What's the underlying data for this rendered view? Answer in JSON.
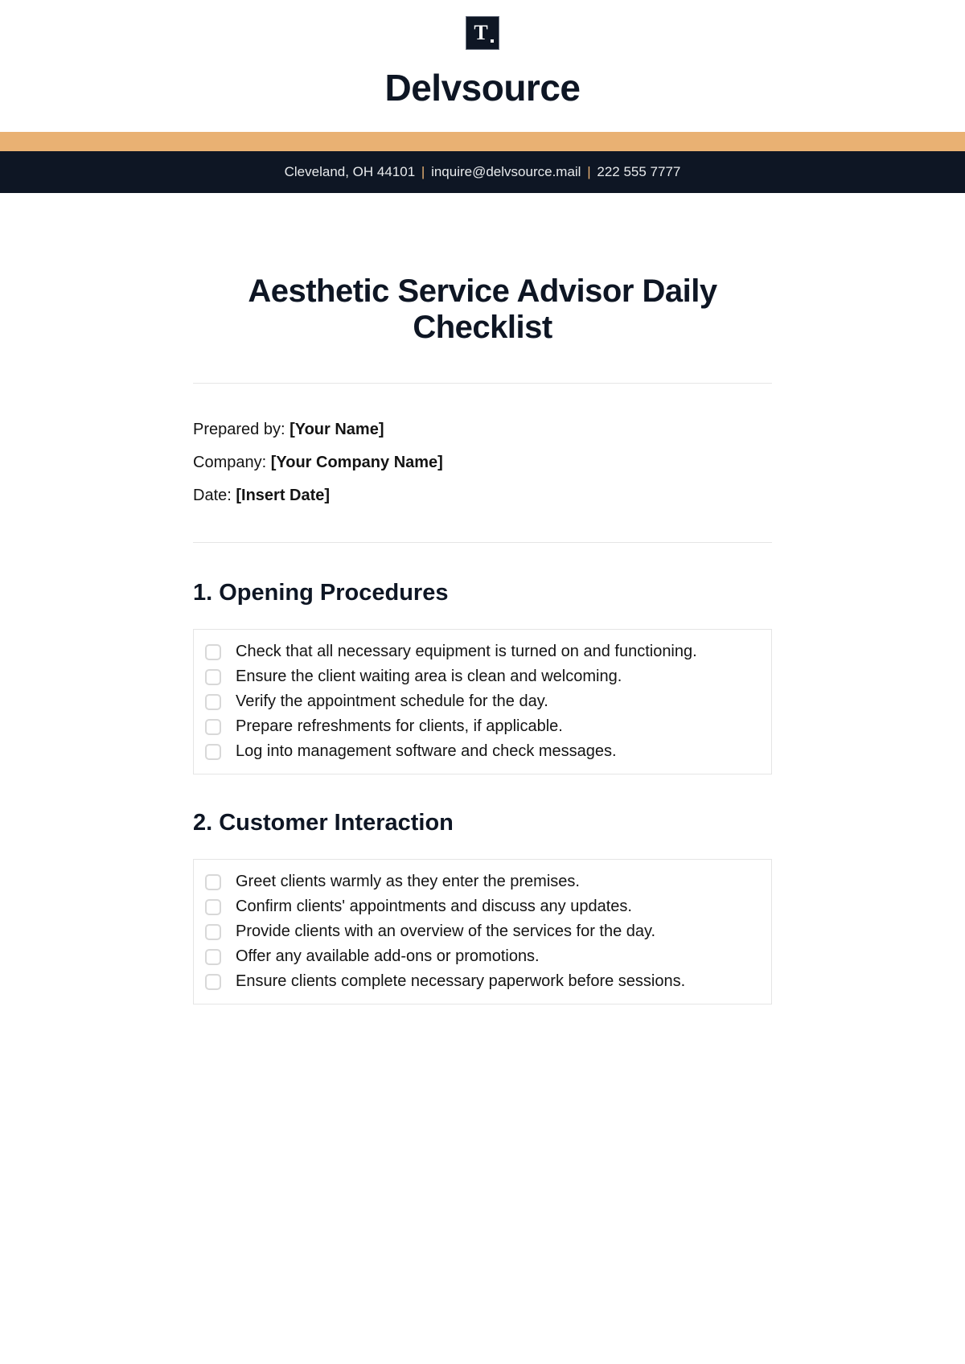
{
  "brand": {
    "logo_letter": "T",
    "company": "Delvsource"
  },
  "contact": {
    "address": "Cleveland, OH 44101",
    "email": "inquire@delvsource.mail",
    "phone": "222 555 7777"
  },
  "document": {
    "title": "Aesthetic Service Advisor Daily Checklist"
  },
  "meta": {
    "prepared_label": "Prepared by: ",
    "prepared_value": "[Your Name]",
    "company_label": "Company: ",
    "company_value": "[Your Company Name]",
    "date_label": "Date: ",
    "date_value": "[Insert Date]"
  },
  "sections": [
    {
      "heading": "1. Opening Procedures",
      "items": [
        "Check that all necessary equipment is turned on and functioning.",
        "Ensure the client waiting area is clean and welcoming.",
        "Verify the appointment schedule for the day.",
        "Prepare refreshments for clients, if applicable.",
        "Log into management software and check messages."
      ]
    },
    {
      "heading": "2. Customer Interaction",
      "items": [
        "Greet clients warmly as they enter the premises.",
        "Confirm clients' appointments and discuss any updates.",
        "Provide clients with an overview of the services for the day.",
        "Offer any available add-ons or promotions.",
        "Ensure clients complete necessary paperwork before sessions."
      ]
    }
  ]
}
